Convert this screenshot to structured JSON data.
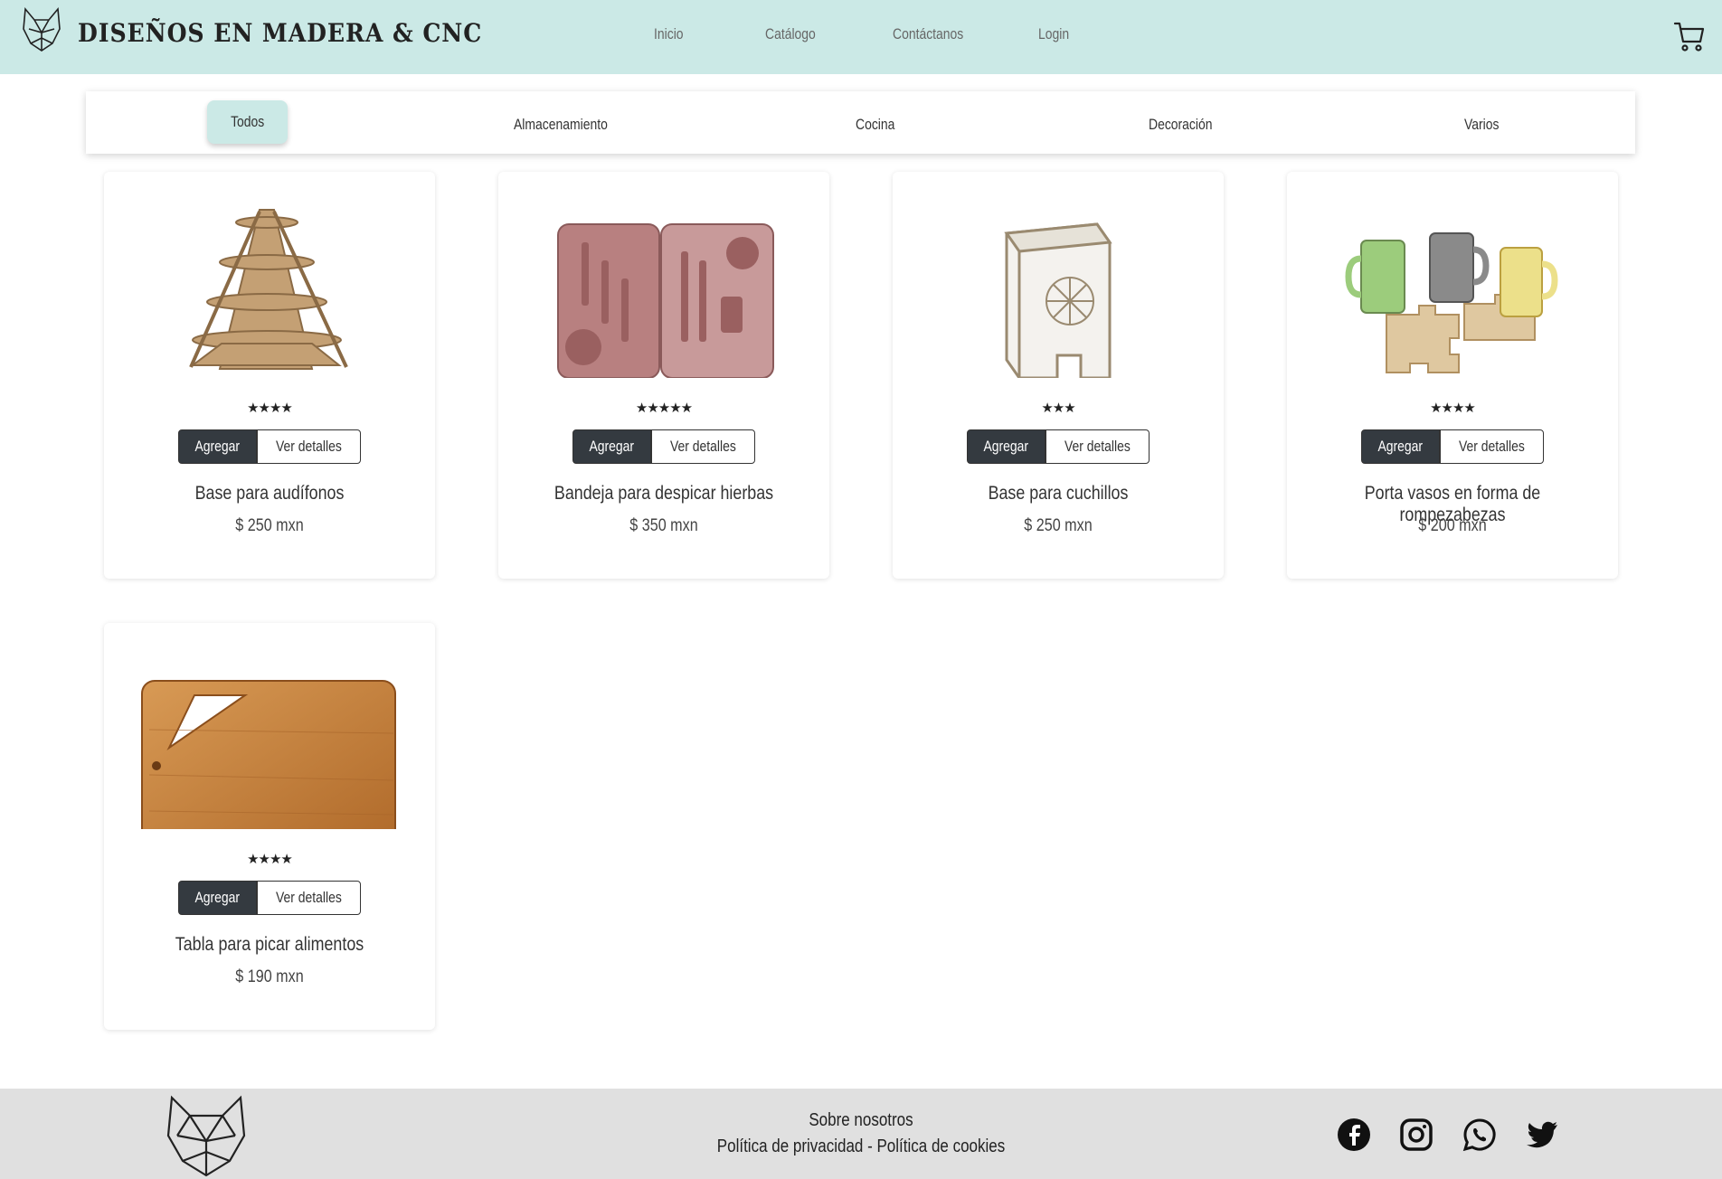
{
  "header": {
    "brand": "DISEÑOS EN MADERA & CNC",
    "nav": [
      "Inicio",
      "Catálogo",
      "Contáctanos",
      "Login"
    ]
  },
  "filters": [
    "Todos",
    "Almacenamiento",
    "Cocina",
    "Decoración",
    "Varios"
  ],
  "products": [
    {
      "name": "Base para audífonos",
      "price": "$ 250 mxn",
      "stars": "★★★★",
      "rating": 4,
      "add": "Agregar",
      "details": "Ver detalles"
    },
    {
      "name": "Bandeja para despicar hierbas",
      "price": "$ 350 mxn",
      "stars": "★★★★★",
      "rating": 5,
      "add": "Agregar",
      "details": "Ver detalles"
    },
    {
      "name": "Base para cuchillos",
      "price": "$ 250 mxn",
      "stars": "★★★",
      "rating": 3,
      "add": "Agregar",
      "details": "Ver detalles"
    },
    {
      "name": "Porta vasos en forma de rompezabezas",
      "price": "$ 200 mxn",
      "stars": "★★★★",
      "rating": 4,
      "add": "Agregar",
      "details": "Ver detalles"
    },
    {
      "name": "Tabla para picar alimentos",
      "price": "$ 190 mxn",
      "stars": "★★★★",
      "rating": 4,
      "add": "Agregar",
      "details": "Ver detalles"
    }
  ],
  "footer": {
    "about": "Sobre nosotros",
    "policies": "Política de privacidad - Política de cookies",
    "social_icons": [
      "facebook-icon",
      "instagram-icon",
      "whatsapp-icon",
      "twitter-icon"
    ]
  },
  "colors": {
    "accent": "#cbe9e6",
    "dark_button": "#343a40",
    "footer": "#e0e0e0"
  }
}
